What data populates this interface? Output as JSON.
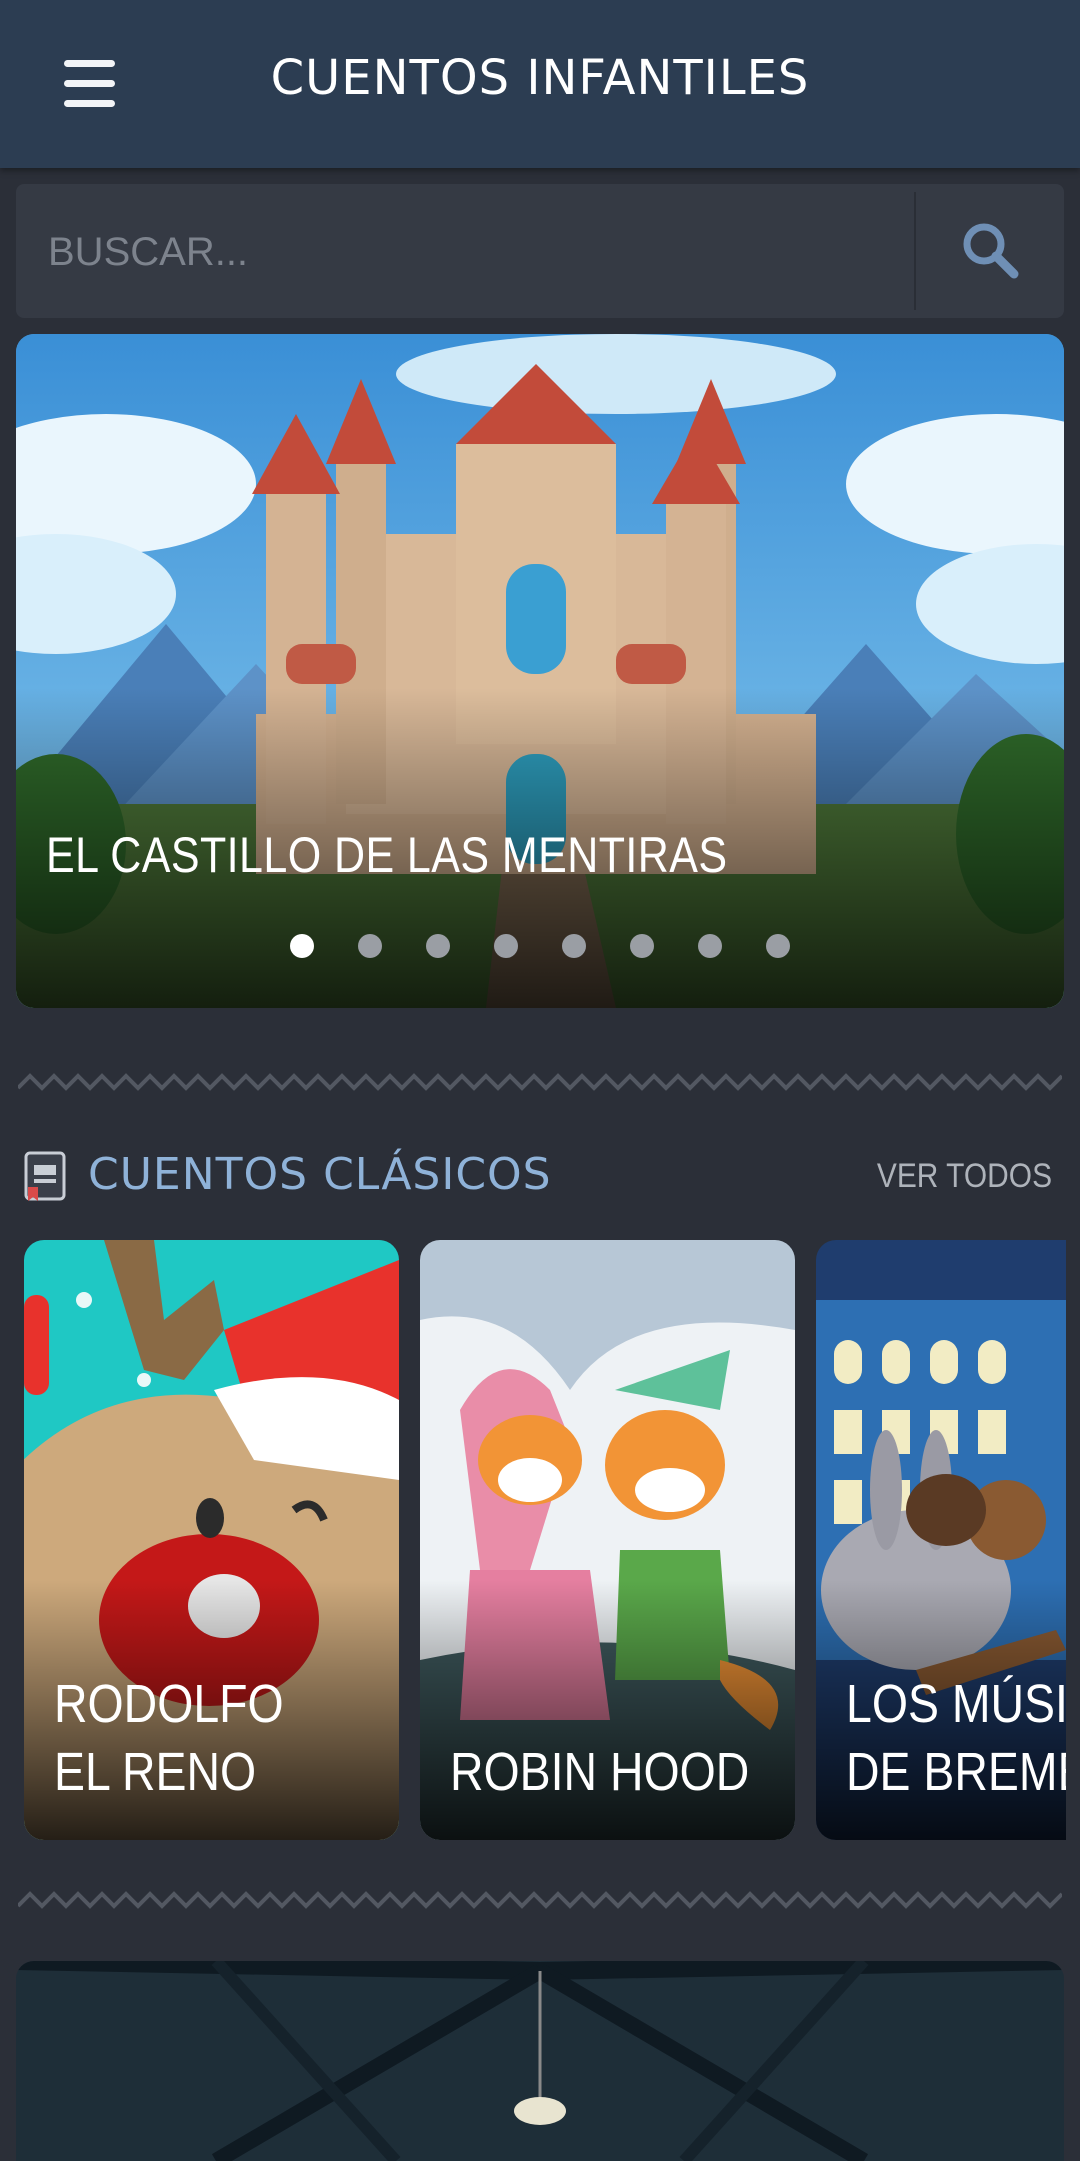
{
  "app_bar": {
    "title": "CUENTOS INFANTILES",
    "menu_icon": "hamburger-menu-icon"
  },
  "search": {
    "placeholder": "BUSCAR...",
    "icon": "search-icon"
  },
  "hero": {
    "title": "EL CASTILLO DE LAS MENTIRAS",
    "image": "castle-illustration",
    "slide_count": 8,
    "active_slide": 1
  },
  "sections": [
    {
      "icon": "book-icon",
      "title": "CUENTOS CLÁSICOS",
      "see_all_label": "VER TODOS",
      "cards": [
        {
          "title": "RODOLFO EL RENO",
          "image": "reindeer-illustration"
        },
        {
          "title": "ROBIN HOOD",
          "image": "fox-couple-illustration"
        },
        {
          "title": "LOS MÚSICOS DE BREMEN",
          "image": "donkey-musicians-illustration"
        }
      ]
    }
  ],
  "colors": {
    "app_bar": "#2c3d52",
    "background": "#2b2f38",
    "search_bg": "#353a44",
    "section_title": "#8fb2d8",
    "accent_icon": "#6f8fb5"
  }
}
